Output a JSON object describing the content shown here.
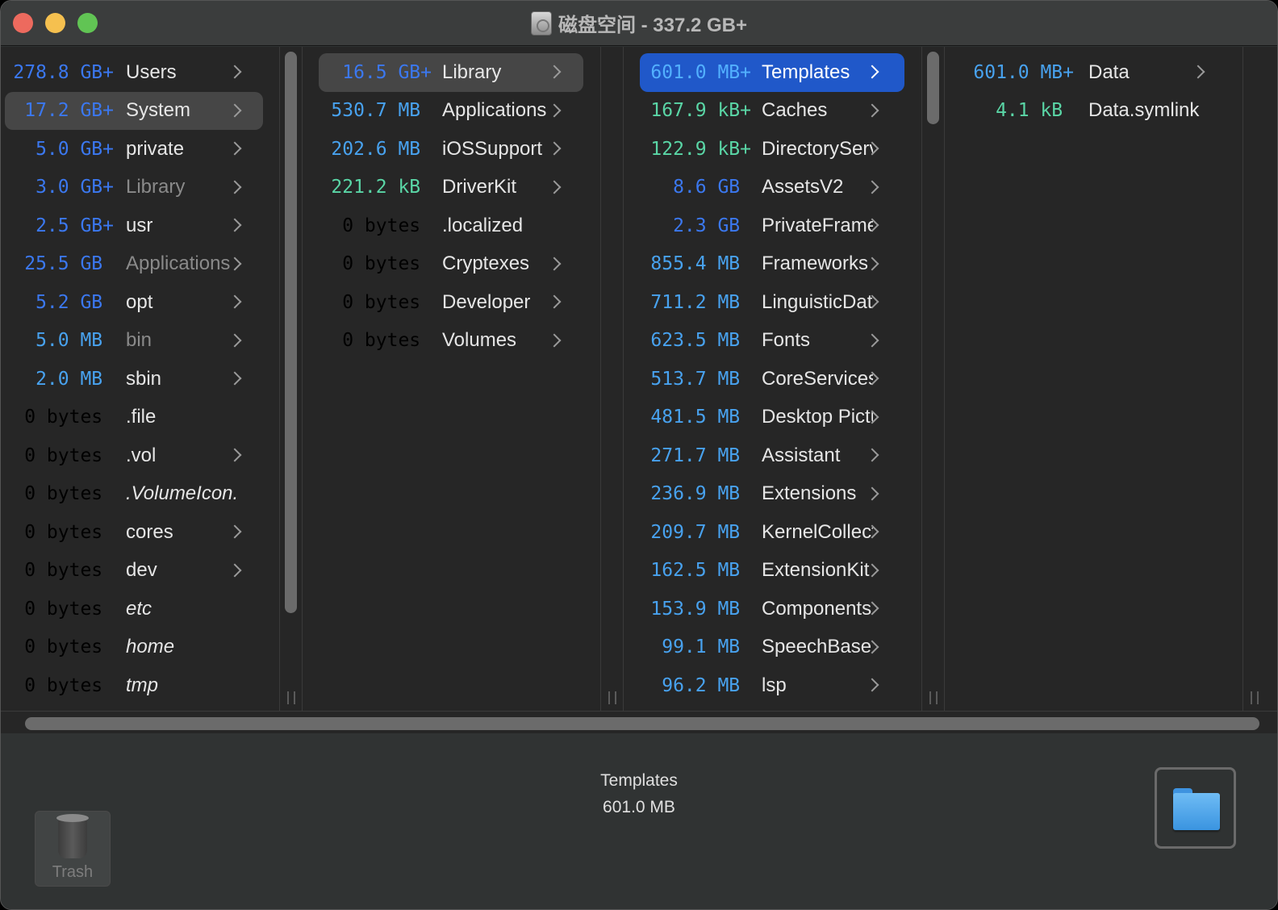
{
  "window": {
    "title": "磁盘空间 - 337.2 GB+",
    "title_icon": "hard-disk-icon"
  },
  "colors": {
    "gb": "#3b78f0",
    "mb": "#48a2ef",
    "kb": "#5ad6a6",
    "bytes": "#5ec93e",
    "selection": "#2058c9"
  },
  "columns": [
    {
      "items": [
        {
          "size": "278.8 GB+",
          "name": "Users",
          "unit": "gb",
          "folder": true
        },
        {
          "size": "17.2 GB+",
          "name": "System",
          "unit": "gb",
          "folder": true,
          "state": "highlighted"
        },
        {
          "size": "5.0 GB+",
          "name": "private",
          "unit": "gb",
          "folder": true
        },
        {
          "size": "3.0 GB+",
          "name": "Library",
          "unit": "gb",
          "folder": true,
          "dim": true
        },
        {
          "size": "2.5 GB+",
          "name": "usr",
          "unit": "gb",
          "folder": true
        },
        {
          "size": "25.5 GB ",
          "name": "Applications",
          "unit": "gb",
          "folder": true,
          "dim": true
        },
        {
          "size": "5.2 GB ",
          "name": "opt",
          "unit": "gb",
          "folder": true
        },
        {
          "size": "5.0 MB ",
          "name": "bin",
          "unit": "mb",
          "folder": true,
          "dim": true
        },
        {
          "size": "2.0 MB ",
          "name": "sbin",
          "unit": "mb",
          "folder": true
        },
        {
          "size": "0 bytes ",
          "name": ".file",
          "unit": "bytes",
          "folder": false
        },
        {
          "size": "0 bytes ",
          "name": ".vol",
          "unit": "bytes",
          "folder": true
        },
        {
          "size": "0 bytes ",
          "name": ".VolumeIcon.",
          "unit": "bytes",
          "folder": false,
          "italic": true
        },
        {
          "size": "0 bytes ",
          "name": "cores",
          "unit": "bytes",
          "folder": true
        },
        {
          "size": "0 bytes ",
          "name": "dev",
          "unit": "bytes",
          "folder": true
        },
        {
          "size": "0 bytes ",
          "name": "etc",
          "unit": "bytes",
          "folder": false,
          "italic": true
        },
        {
          "size": "0 bytes ",
          "name": "home",
          "unit": "bytes",
          "folder": false,
          "italic": true
        },
        {
          "size": "0 bytes ",
          "name": "tmp",
          "unit": "bytes",
          "folder": false,
          "italic": true
        }
      ]
    },
    {
      "items": [
        {
          "size": "16.5 GB+",
          "name": "Library",
          "unit": "gb",
          "folder": true,
          "state": "highlighted"
        },
        {
          "size": "530.7 MB ",
          "name": "Applications",
          "unit": "mb",
          "folder": true
        },
        {
          "size": "202.6 MB ",
          "name": "iOSSupport",
          "unit": "mb",
          "folder": true
        },
        {
          "size": "221.2 kB ",
          "name": "DriverKit",
          "unit": "kb",
          "folder": true
        },
        {
          "size": "0 bytes ",
          "name": ".localized",
          "unit": "bytes",
          "folder": false
        },
        {
          "size": "0 bytes ",
          "name": "Cryptexes",
          "unit": "bytes",
          "folder": true
        },
        {
          "size": "0 bytes ",
          "name": "Developer",
          "unit": "bytes",
          "folder": true
        },
        {
          "size": "0 bytes ",
          "name": "Volumes",
          "unit": "bytes",
          "folder": true
        }
      ]
    },
    {
      "items": [
        {
          "size": "601.0 MB+",
          "name": "Templates",
          "unit": "mb",
          "folder": true,
          "state": "selected"
        },
        {
          "size": "167.9 kB+",
          "name": "Caches",
          "unit": "kb",
          "folder": true
        },
        {
          "size": "122.9 kB+",
          "name": "DirectoryServices",
          "unit": "kb",
          "folder": true
        },
        {
          "size": "8.6 GB ",
          "name": "AssetsV2",
          "unit": "gb",
          "folder": true
        },
        {
          "size": "2.3 GB ",
          "name": "PrivateFrameworks",
          "unit": "gb",
          "folder": true
        },
        {
          "size": "855.4 MB ",
          "name": "Frameworks",
          "unit": "mb",
          "folder": true
        },
        {
          "size": "711.2 MB ",
          "name": "LinguisticData",
          "unit": "mb",
          "folder": true
        },
        {
          "size": "623.5 MB ",
          "name": "Fonts",
          "unit": "mb",
          "folder": true
        },
        {
          "size": "513.7 MB ",
          "name": "CoreServices",
          "unit": "mb",
          "folder": true
        },
        {
          "size": "481.5 MB ",
          "name": "Desktop Pictures",
          "unit": "mb",
          "folder": true
        },
        {
          "size": "271.7 MB ",
          "name": "Assistant",
          "unit": "mb",
          "folder": true
        },
        {
          "size": "236.9 MB ",
          "name": "Extensions",
          "unit": "mb",
          "folder": true
        },
        {
          "size": "209.7 MB ",
          "name": "KernelCollections",
          "unit": "mb",
          "folder": true
        },
        {
          "size": "162.5 MB ",
          "name": "ExtensionKit",
          "unit": "mb",
          "folder": true
        },
        {
          "size": "153.9 MB ",
          "name": "Components",
          "unit": "mb",
          "folder": true
        },
        {
          "size": "99.1 MB ",
          "name": "SpeechBase",
          "unit": "mb",
          "folder": true
        },
        {
          "size": "96.2 MB ",
          "name": "lsp",
          "unit": "mb",
          "folder": true
        }
      ]
    },
    {
      "items": [
        {
          "size": "601.0 MB+",
          "name": "Data",
          "unit": "mb",
          "folder": true
        },
        {
          "size": "4.1 kB ",
          "name": "Data.symlink",
          "unit": "kb",
          "folder": false
        }
      ]
    }
  ],
  "footer": {
    "trash_label": "Trash",
    "selected_name": "Templates",
    "selected_size": "601.0 MB",
    "reveal_icon": "folder-icon"
  }
}
